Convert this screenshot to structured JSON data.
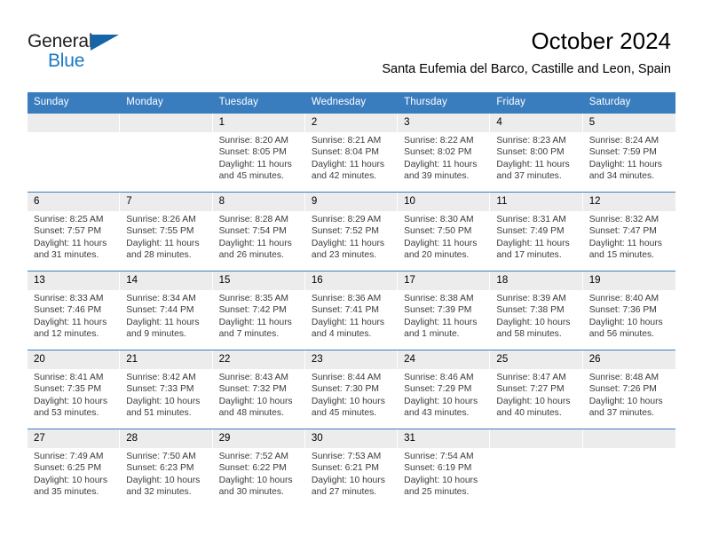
{
  "logo": {
    "word1": "General",
    "word2": "Blue",
    "accent_color": "#1879c4",
    "triangle_color": "#1565a8"
  },
  "header": {
    "title": "October 2024",
    "subtitle": "Santa Eufemia del Barco, Castille and Leon, Spain"
  },
  "theme": {
    "header_row_bg": "#3a7dbf",
    "daynum_bg": "#ececec",
    "row_divider": "#3a7dbf"
  },
  "weekdays": [
    "Sunday",
    "Monday",
    "Tuesday",
    "Wednesday",
    "Thursday",
    "Friday",
    "Saturday"
  ],
  "weeks": [
    [
      {
        "day": "",
        "sunrise": "",
        "sunset": "",
        "daylight1": "",
        "daylight2": ""
      },
      {
        "day": "",
        "sunrise": "",
        "sunset": "",
        "daylight1": "",
        "daylight2": ""
      },
      {
        "day": "1",
        "sunrise": "Sunrise: 8:20 AM",
        "sunset": "Sunset: 8:05 PM",
        "daylight1": "Daylight: 11 hours",
        "daylight2": "and 45 minutes."
      },
      {
        "day": "2",
        "sunrise": "Sunrise: 8:21 AM",
        "sunset": "Sunset: 8:04 PM",
        "daylight1": "Daylight: 11 hours",
        "daylight2": "and 42 minutes."
      },
      {
        "day": "3",
        "sunrise": "Sunrise: 8:22 AM",
        "sunset": "Sunset: 8:02 PM",
        "daylight1": "Daylight: 11 hours",
        "daylight2": "and 39 minutes."
      },
      {
        "day": "4",
        "sunrise": "Sunrise: 8:23 AM",
        "sunset": "Sunset: 8:00 PM",
        "daylight1": "Daylight: 11 hours",
        "daylight2": "and 37 minutes."
      },
      {
        "day": "5",
        "sunrise": "Sunrise: 8:24 AM",
        "sunset": "Sunset: 7:59 PM",
        "daylight1": "Daylight: 11 hours",
        "daylight2": "and 34 minutes."
      }
    ],
    [
      {
        "day": "6",
        "sunrise": "Sunrise: 8:25 AM",
        "sunset": "Sunset: 7:57 PM",
        "daylight1": "Daylight: 11 hours",
        "daylight2": "and 31 minutes."
      },
      {
        "day": "7",
        "sunrise": "Sunrise: 8:26 AM",
        "sunset": "Sunset: 7:55 PM",
        "daylight1": "Daylight: 11 hours",
        "daylight2": "and 28 minutes."
      },
      {
        "day": "8",
        "sunrise": "Sunrise: 8:28 AM",
        "sunset": "Sunset: 7:54 PM",
        "daylight1": "Daylight: 11 hours",
        "daylight2": "and 26 minutes."
      },
      {
        "day": "9",
        "sunrise": "Sunrise: 8:29 AM",
        "sunset": "Sunset: 7:52 PM",
        "daylight1": "Daylight: 11 hours",
        "daylight2": "and 23 minutes."
      },
      {
        "day": "10",
        "sunrise": "Sunrise: 8:30 AM",
        "sunset": "Sunset: 7:50 PM",
        "daylight1": "Daylight: 11 hours",
        "daylight2": "and 20 minutes."
      },
      {
        "day": "11",
        "sunrise": "Sunrise: 8:31 AM",
        "sunset": "Sunset: 7:49 PM",
        "daylight1": "Daylight: 11 hours",
        "daylight2": "and 17 minutes."
      },
      {
        "day": "12",
        "sunrise": "Sunrise: 8:32 AM",
        "sunset": "Sunset: 7:47 PM",
        "daylight1": "Daylight: 11 hours",
        "daylight2": "and 15 minutes."
      }
    ],
    [
      {
        "day": "13",
        "sunrise": "Sunrise: 8:33 AM",
        "sunset": "Sunset: 7:46 PM",
        "daylight1": "Daylight: 11 hours",
        "daylight2": "and 12 minutes."
      },
      {
        "day": "14",
        "sunrise": "Sunrise: 8:34 AM",
        "sunset": "Sunset: 7:44 PM",
        "daylight1": "Daylight: 11 hours",
        "daylight2": "and 9 minutes."
      },
      {
        "day": "15",
        "sunrise": "Sunrise: 8:35 AM",
        "sunset": "Sunset: 7:42 PM",
        "daylight1": "Daylight: 11 hours",
        "daylight2": "and 7 minutes."
      },
      {
        "day": "16",
        "sunrise": "Sunrise: 8:36 AM",
        "sunset": "Sunset: 7:41 PM",
        "daylight1": "Daylight: 11 hours",
        "daylight2": "and 4 minutes."
      },
      {
        "day": "17",
        "sunrise": "Sunrise: 8:38 AM",
        "sunset": "Sunset: 7:39 PM",
        "daylight1": "Daylight: 11 hours",
        "daylight2": "and 1 minute."
      },
      {
        "day": "18",
        "sunrise": "Sunrise: 8:39 AM",
        "sunset": "Sunset: 7:38 PM",
        "daylight1": "Daylight: 10 hours",
        "daylight2": "and 58 minutes."
      },
      {
        "day": "19",
        "sunrise": "Sunrise: 8:40 AM",
        "sunset": "Sunset: 7:36 PM",
        "daylight1": "Daylight: 10 hours",
        "daylight2": "and 56 minutes."
      }
    ],
    [
      {
        "day": "20",
        "sunrise": "Sunrise: 8:41 AM",
        "sunset": "Sunset: 7:35 PM",
        "daylight1": "Daylight: 10 hours",
        "daylight2": "and 53 minutes."
      },
      {
        "day": "21",
        "sunrise": "Sunrise: 8:42 AM",
        "sunset": "Sunset: 7:33 PM",
        "daylight1": "Daylight: 10 hours",
        "daylight2": "and 51 minutes."
      },
      {
        "day": "22",
        "sunrise": "Sunrise: 8:43 AM",
        "sunset": "Sunset: 7:32 PM",
        "daylight1": "Daylight: 10 hours",
        "daylight2": "and 48 minutes."
      },
      {
        "day": "23",
        "sunrise": "Sunrise: 8:44 AM",
        "sunset": "Sunset: 7:30 PM",
        "daylight1": "Daylight: 10 hours",
        "daylight2": "and 45 minutes."
      },
      {
        "day": "24",
        "sunrise": "Sunrise: 8:46 AM",
        "sunset": "Sunset: 7:29 PM",
        "daylight1": "Daylight: 10 hours",
        "daylight2": "and 43 minutes."
      },
      {
        "day": "25",
        "sunrise": "Sunrise: 8:47 AM",
        "sunset": "Sunset: 7:27 PM",
        "daylight1": "Daylight: 10 hours",
        "daylight2": "and 40 minutes."
      },
      {
        "day": "26",
        "sunrise": "Sunrise: 8:48 AM",
        "sunset": "Sunset: 7:26 PM",
        "daylight1": "Daylight: 10 hours",
        "daylight2": "and 37 minutes."
      }
    ],
    [
      {
        "day": "27",
        "sunrise": "Sunrise: 7:49 AM",
        "sunset": "Sunset: 6:25 PM",
        "daylight1": "Daylight: 10 hours",
        "daylight2": "and 35 minutes."
      },
      {
        "day": "28",
        "sunrise": "Sunrise: 7:50 AM",
        "sunset": "Sunset: 6:23 PM",
        "daylight1": "Daylight: 10 hours",
        "daylight2": "and 32 minutes."
      },
      {
        "day": "29",
        "sunrise": "Sunrise: 7:52 AM",
        "sunset": "Sunset: 6:22 PM",
        "daylight1": "Daylight: 10 hours",
        "daylight2": "and 30 minutes."
      },
      {
        "day": "30",
        "sunrise": "Sunrise: 7:53 AM",
        "sunset": "Sunset: 6:21 PM",
        "daylight1": "Daylight: 10 hours",
        "daylight2": "and 27 minutes."
      },
      {
        "day": "31",
        "sunrise": "Sunrise: 7:54 AM",
        "sunset": "Sunset: 6:19 PM",
        "daylight1": "Daylight: 10 hours",
        "daylight2": "and 25 minutes."
      },
      {
        "day": "",
        "sunrise": "",
        "sunset": "",
        "daylight1": "",
        "daylight2": ""
      },
      {
        "day": "",
        "sunrise": "",
        "sunset": "",
        "daylight1": "",
        "daylight2": ""
      }
    ]
  ]
}
